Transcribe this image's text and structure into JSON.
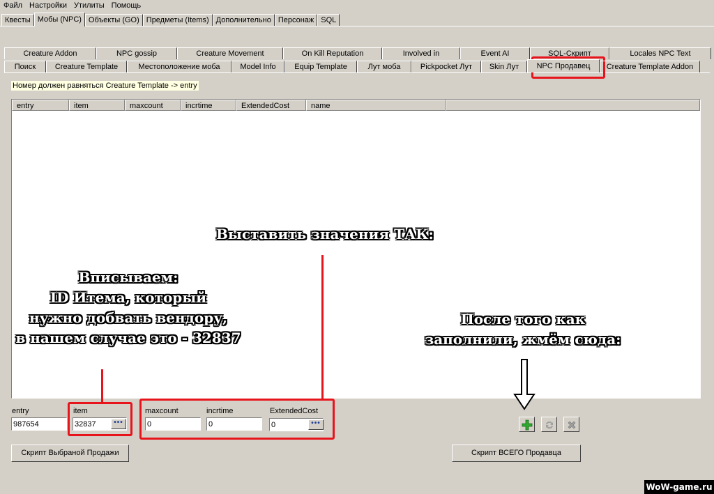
{
  "menu": [
    "Файл",
    "Настройки",
    "Утилиты",
    "Помощь"
  ],
  "main_tabs": [
    "Квесты",
    "Мобы (NPC)",
    "Объекты (GO)",
    "Предметы (Items)",
    "Дополнительно",
    "Персонаж",
    "SQL"
  ],
  "main_active": "Мобы (NPC)",
  "subtabs_row1": [
    "Creature Addon",
    "NPC gossip",
    "Creature Movement",
    "On Kill Reputation",
    "Involved in",
    "Event AI",
    "SQL-Скрипт",
    "Locales NPC Text"
  ],
  "subtabs_row2": [
    "Поиск",
    "Creature Template",
    "Местоположение моба",
    "Model Info",
    "Equip Template",
    "Лут моба",
    "Pickpocket Лут",
    "Skin Лут",
    "NPC Продавец",
    "Creature Template Addon"
  ],
  "subtab_active": "NPC Продавец",
  "note": "Номер должен равняться Creature Template -> entry",
  "grid_columns": [
    "entry",
    "item",
    "maxcount",
    "incrtime",
    "ExtendedCost",
    "name"
  ],
  "fields": {
    "entry": {
      "label": "entry",
      "value": "987654"
    },
    "item": {
      "label": "item",
      "value": "32837"
    },
    "maxcount": {
      "label": "maxcount",
      "value": "0"
    },
    "incrtime": {
      "label": "incrtime",
      "value": "0"
    },
    "extendedcost": {
      "label": "ExtendedCost",
      "value": "0"
    }
  },
  "ellipsis": "•••",
  "buttons": {
    "script_selected": "Скрипт Выбраной Продажи",
    "script_all": "Скрипт ВСЕГО Продавца"
  },
  "icons": {
    "add": "plus-icon",
    "refresh": "refresh-icon",
    "delete": "delete-icon"
  },
  "annotations": {
    "set_values": "Выставить значения ТАК:",
    "enter_lines": [
      "Вписываем:",
      "ID Итема, который",
      "нужно добвать вендору,",
      "в нашем случае это - 32837"
    ],
    "after_lines": [
      "После того как",
      "заполнили, жмём сюда:"
    ]
  },
  "watermark": "WoW-game.ru",
  "colors": {
    "highlight": "#e8141c",
    "window": "#d4d0c8",
    "note_bg": "#ffffe1"
  }
}
